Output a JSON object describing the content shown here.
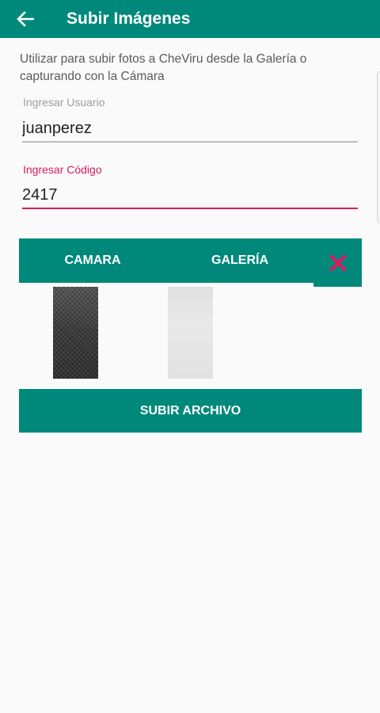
{
  "header": {
    "title": "Subir Imágenes",
    "back_icon": "arrow-back-icon"
  },
  "description": "Utilizar para subir fotos a CheViru desde la Galería o capturando con la Cámara",
  "form": {
    "user_label": "Ingresar Usuario",
    "user_value": "juanperez",
    "code_label": "Ingresar Código",
    "code_value": "2417"
  },
  "tabs": {
    "camera_label": "CAMARA",
    "gallery_label": "GALERÍA",
    "close_icon": "close-icon"
  },
  "upload": {
    "label": "SUBIR ARCHIVO"
  },
  "colors": {
    "primary": "#00897b",
    "accent": "#d81b60",
    "background": "#fafafa"
  }
}
